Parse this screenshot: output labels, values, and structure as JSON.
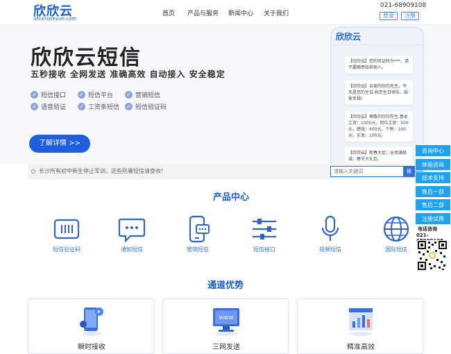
{
  "header": {
    "logo": "欣欣云",
    "logo_sub": "Shixinxinyun.com",
    "nav": [
      "首页",
      "产品与服务",
      "新闻中心",
      "关于我们"
    ],
    "phone": "021-68909108",
    "login": "登录",
    "register": "注册"
  },
  "hero": {
    "title": "欣欣云短信",
    "slogan": "五秒接收  全网发送  准确高效  自动接入  安全稳定",
    "features": [
      "短信接口",
      "短信平台",
      "营销短信",
      "语音验证",
      "工资条短信",
      "短信验证码"
    ],
    "detail_button": "了解详情 >>"
  },
  "phone_mockup": {
    "title": "欣欣云",
    "messages": [
      "【欣欣云】您的验证码为***，请不要随意给其他人。",
      "【欣欣云】亲爱的欣欣先生，今天是您的生日,祝您生日快乐，阖家幸福!",
      "【欣欣云】尊敬的欣欣先生,基本工资：1000元，岗位工资：500元，绩效：600元，个税：100元，实发：100元。",
      "【欣欣云】新春大促，全场满就减，春节大礼包。"
    ]
  },
  "notice": {
    "text": "长沙所有初中新生停止军训，这些防暑短信请查收!",
    "search_placeholder": "请输入关键词",
    "search_button": "搜"
  },
  "products": {
    "title": "产品中心",
    "items": [
      {
        "label": "短信验证码",
        "icon": "sms-code-icon"
      },
      {
        "label": "通知短信",
        "icon": "chat-bubble-icon"
      },
      {
        "label": "营销短信",
        "icon": "mobile-message-icon"
      },
      {
        "label": "短信接口",
        "icon": "sliders-icon"
      },
      {
        "label": "视频短信",
        "icon": "microphone-icon"
      },
      {
        "label": "国际短信",
        "icon": "globe-icon"
      }
    ]
  },
  "advantages": {
    "title": "通道优势",
    "cards": [
      {
        "label": "瞬时接收"
      },
      {
        "label": "三网发送"
      },
      {
        "label": "精准高效"
      }
    ]
  },
  "side_panel": {
    "buttons": [
      "咨询中心",
      "休验咨询",
      "技术支持",
      "售后一部",
      "售后二部",
      "注册试用"
    ],
    "phone_label": "电话咨询",
    "phone_number": "021-68909108"
  },
  "colors": {
    "brand": "#1a5fd0",
    "accent": "#1e5fe0",
    "side": "#1da1f2"
  }
}
